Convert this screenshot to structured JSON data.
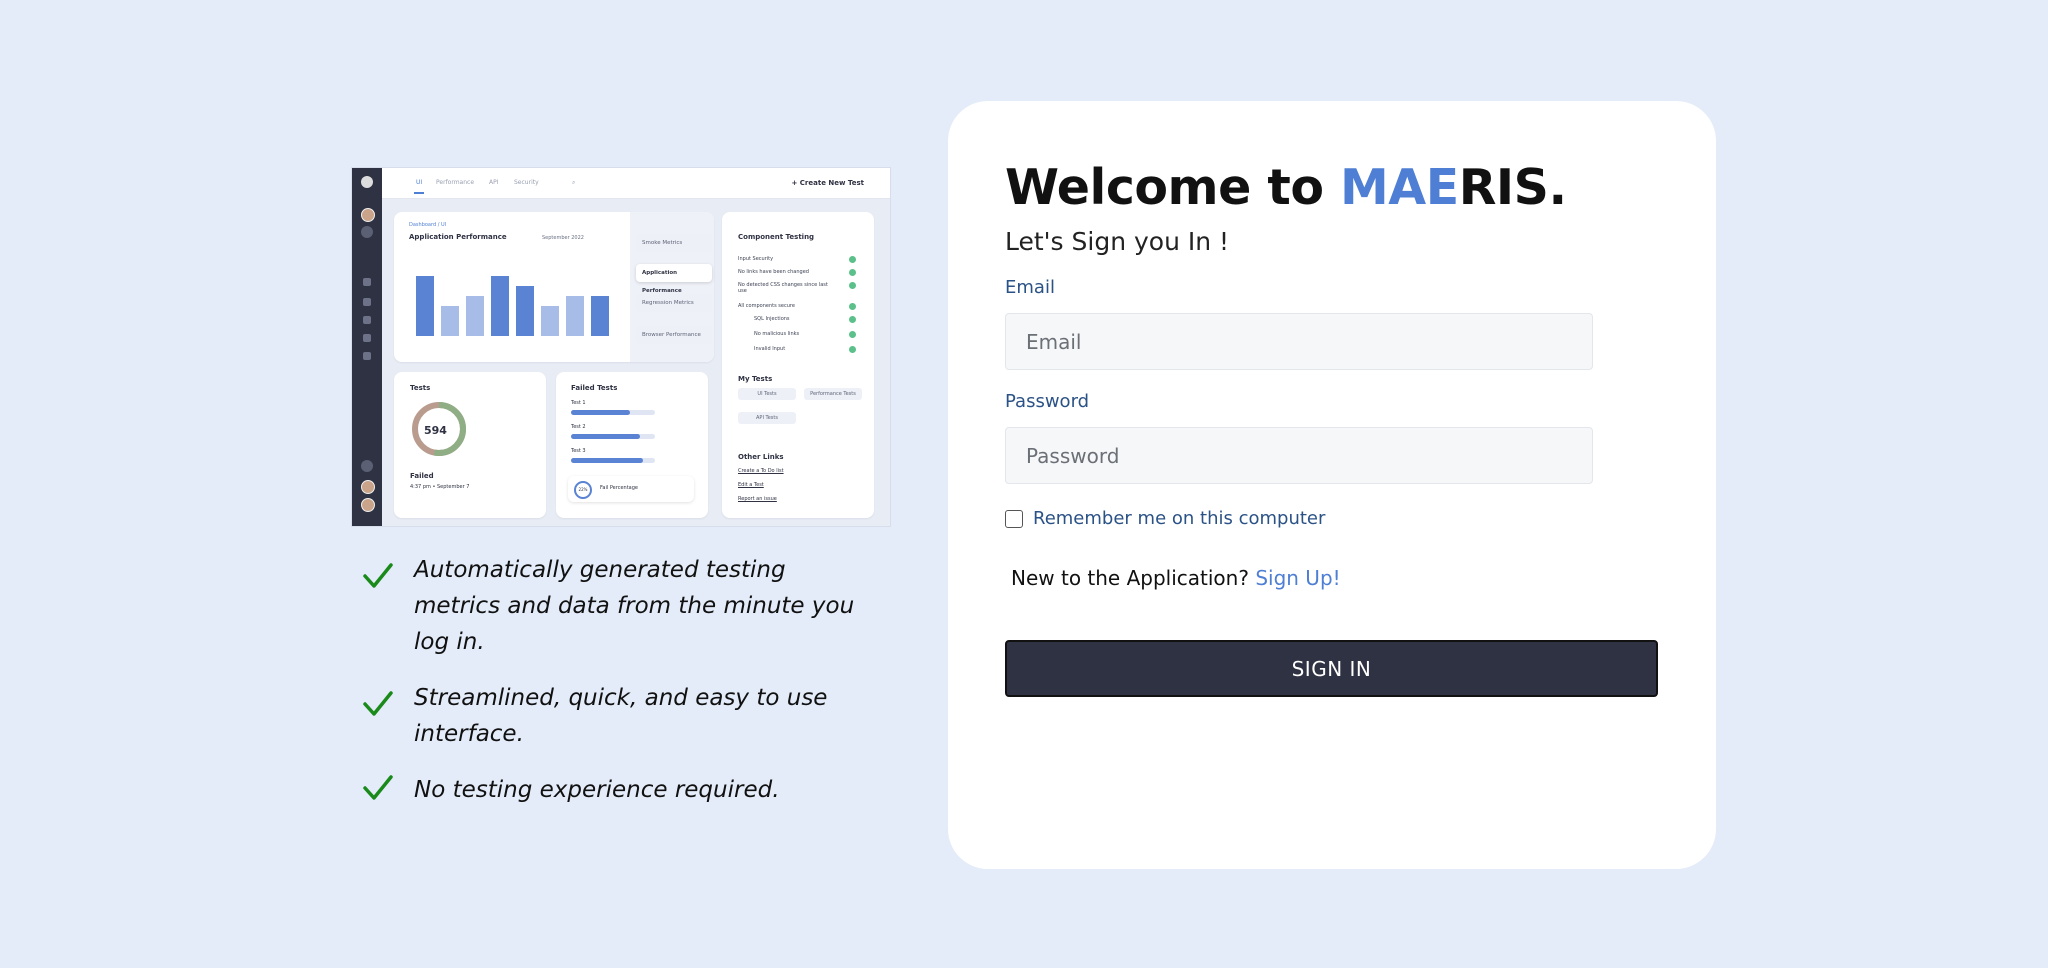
{
  "brand": {
    "prefix": "Welcome to ",
    "name_accent": "MAE",
    "name_rest": "RIS.",
    "accent_color": "#4f7fd4"
  },
  "login": {
    "subtitle": "Let's Sign you In !",
    "email_label": "Email",
    "email_placeholder": "Email",
    "email_value": "",
    "password_label": "Password",
    "password_placeholder": "Password",
    "password_value": "",
    "remember_label": "Remember me on this computer",
    "remember_checked": false,
    "signup_prompt": "New to the Application?",
    "signup_link": "Sign Up!",
    "signin_label": "SIGN IN",
    "button_color": "#2f3243"
  },
  "features": [
    {
      "icon": "checkmark-icon",
      "text": "Automatically generated testing metrics and data from the minute you log in."
    },
    {
      "icon": "checkmark-icon",
      "text": "Streamlined, quick, and easy to use interface."
    },
    {
      "icon": "checkmark-icon",
      "text": "No testing experience required."
    }
  ],
  "preview": {
    "tabs": [
      "UI",
      "Performance",
      "API",
      "Security"
    ],
    "create_label": "+ Create New Test",
    "breadcrumb": "Dashboard  /  UI",
    "perf_title": "Application Performance",
    "perf_date": "September 2022",
    "perf_bars": [
      0.75,
      0.38,
      0.5,
      0.75,
      0.63,
      0.38,
      0.5,
      0.5
    ],
    "metrics": [
      "Smoke Metrics",
      "Application Performance",
      "Regression Metrics",
      "Browser Performance"
    ],
    "comp_title": "Component Testing",
    "comp_items": [
      "Input Security",
      "No links have been changed",
      "No detected CSS changes since last use",
      "All components secure",
      "SQL Injections",
      "No malicious links",
      "Invalid Input"
    ],
    "mytests_title": "My Tests",
    "mytests": [
      "UI Tests",
      "Performance Tests",
      "API Tests"
    ],
    "links_title": "Other Links",
    "links": [
      "Create a To Do list",
      "Edit a Test",
      "Report an issue"
    ],
    "tests_title": "Tests",
    "tests_total": "594",
    "failed_label": "Failed",
    "failed_time": "4:37 pm • September 7",
    "failed_tests_title": "Failed Tests",
    "failed_tests": [
      {
        "name": "Test 1",
        "fraction": 0.7
      },
      {
        "name": "Test 2",
        "fraction": 0.82
      },
      {
        "name": "Test 3",
        "fraction": 0.86
      }
    ],
    "fail_pct": "22%",
    "fail_pct_label": "Fail Percentage"
  }
}
